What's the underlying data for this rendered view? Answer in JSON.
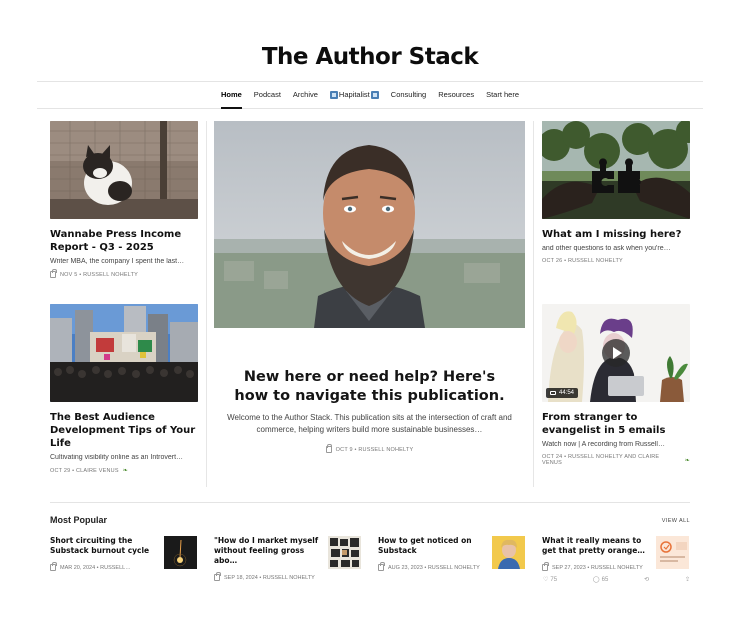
{
  "masthead": {
    "title": "The Author Stack"
  },
  "nav": {
    "items": [
      {
        "label": "Home",
        "active": true
      },
      {
        "label": "Podcast"
      },
      {
        "label": "Archive"
      },
      {
        "label": "Hapitalist",
        "icon": "hapitalist-icon"
      },
      {
        "label": "Consulting"
      },
      {
        "label": "Resources"
      },
      {
        "label": "Start here"
      }
    ]
  },
  "left_cards": [
    {
      "title": "Wannabe Press Income Report - Q3 - 2025",
      "subtitle": "Writer MBA, the company I spent the last…",
      "meta": "NOV 5 • RUSSELL NOHELTY"
    },
    {
      "title": "The Best Audience Development Tips of Your Life",
      "subtitle": "Cultivating visibility online as an Introvert…",
      "meta": "OCT 29 • CLAIRE VENUS"
    }
  ],
  "feature": {
    "title": "New here or need help? Here's how to navigate this publication.",
    "description": "Welcome to the Author Stack. This publication sits at the intersection of craft and commerce, helping writers build more sustainable businesses…",
    "meta": "OCT 9 • RUSSELL NOHELTY"
  },
  "right_cards": [
    {
      "title": "What am I missing here?",
      "subtitle": "and other questions to ask when you're…",
      "meta": "OCT 26 • RUSSELL NOHELTY"
    },
    {
      "title": "From stranger to evangelist in 5 emails",
      "subtitle": "Watch now | A recording from Russell…",
      "meta": "OCT 24 • RUSSELL NOHELTY AND CLAIRE VENUS",
      "video_duration": "44:54"
    }
  ],
  "popular": {
    "heading": "Most Popular",
    "view_all": "VIEW ALL",
    "items": [
      {
        "title": "Short circuiting the Substack burnout cycle",
        "meta": "MAR 20, 2024 • RUSSELL…"
      },
      {
        "title": "\"How do I market myself without feeling gross abo…",
        "meta": "SEP 18, 2024 • RUSSELL NOHELTY"
      },
      {
        "title": "How to get noticed on Substack",
        "meta": "AUG 23, 2023 • RUSSELL NOHELTY"
      },
      {
        "title": "What it really means to get that pretty orange…",
        "meta": "SEP 27, 2023 • RUSSELL NOHELTY"
      }
    ],
    "stats": {
      "likes": "75",
      "comments": "65"
    }
  }
}
